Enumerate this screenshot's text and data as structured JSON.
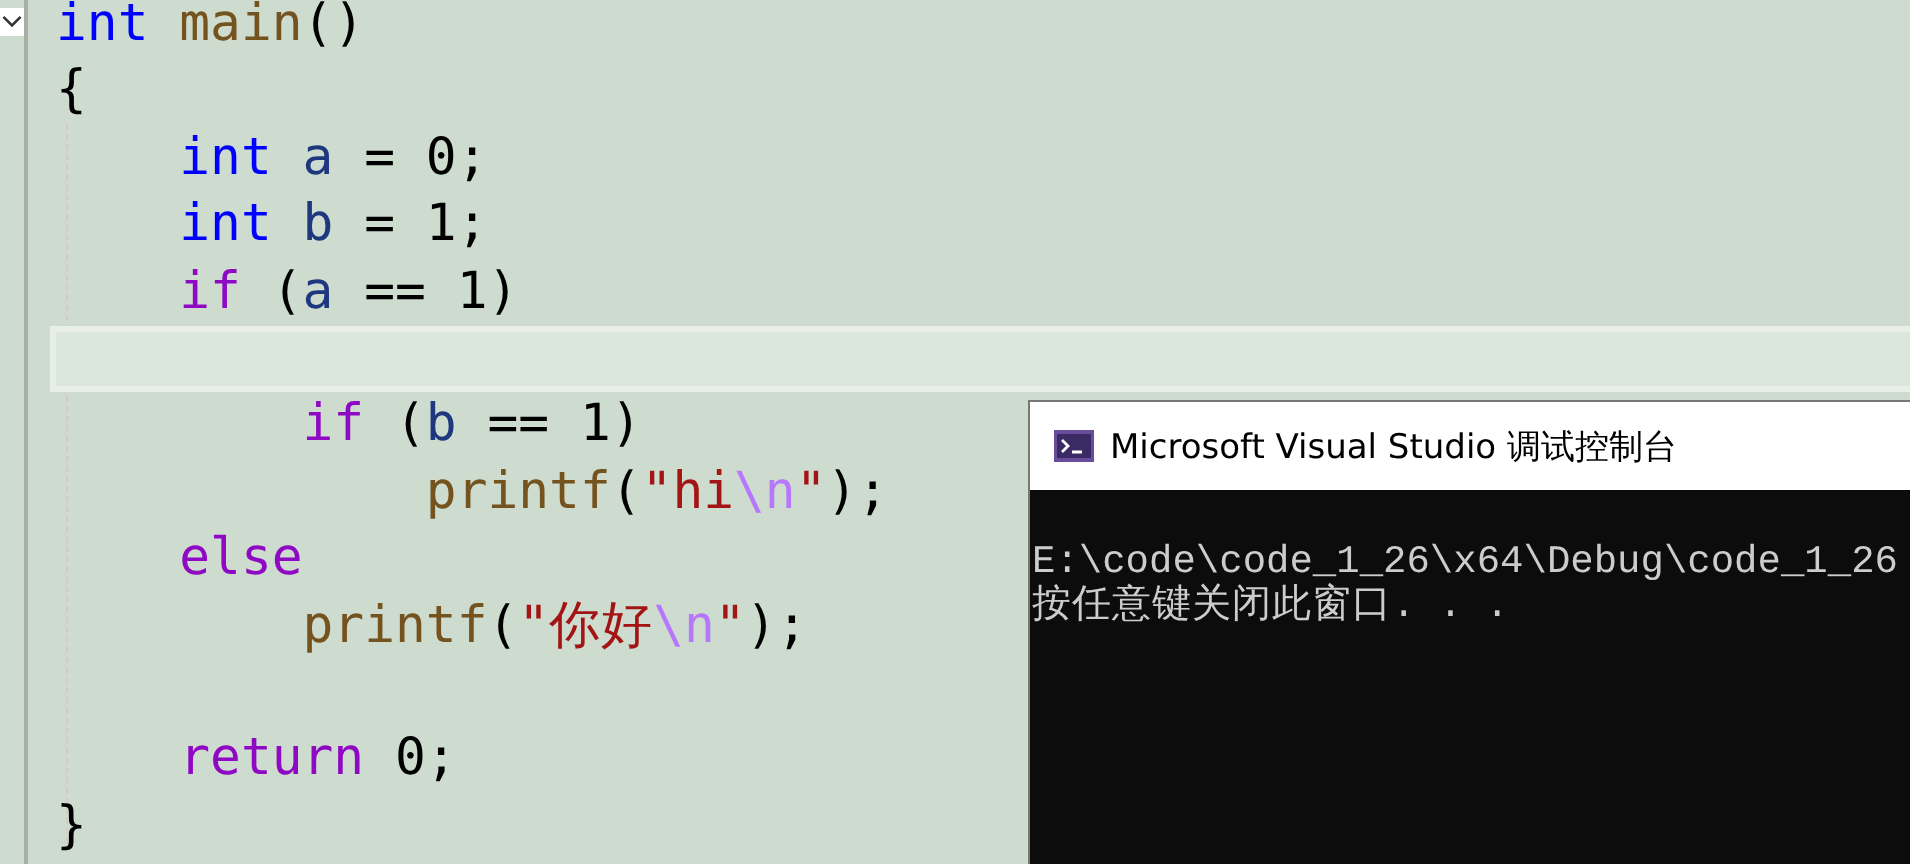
{
  "editor": {
    "lines": [
      {
        "current": false,
        "expanded": true,
        "tokens": [
          {
            "text": "int",
            "kind": "keyword"
          },
          {
            "text": " main",
            "kind": "function"
          },
          {
            "text": "()",
            "kind": "plain"
          }
        ]
      },
      {
        "current": false,
        "tokens": [
          {
            "text": "{",
            "kind": "plain"
          }
        ]
      },
      {
        "current": false,
        "tokens": [
          {
            "text": "    int",
            "kind": "keyword"
          },
          {
            "text": " a",
            "kind": "variable"
          },
          {
            "text": " = 0;",
            "kind": "plain"
          }
        ]
      },
      {
        "current": false,
        "tokens": [
          {
            "text": "    int",
            "kind": "keyword"
          },
          {
            "text": " b",
            "kind": "variable"
          },
          {
            "text": " = 1;",
            "kind": "plain"
          }
        ]
      },
      {
        "current": false,
        "tokens": [
          {
            "text": "    if",
            "kind": "control"
          },
          {
            "text": " (",
            "kind": "plain"
          },
          {
            "text": "a",
            "kind": "variable"
          },
          {
            "text": " == 1)",
            "kind": "plain"
          }
        ]
      },
      {
        "current": true
      },
      {
        "current": false,
        "tokens": [
          {
            "text": "        if",
            "kind": "control"
          },
          {
            "text": " (",
            "kind": "plain"
          },
          {
            "text": "b",
            "kind": "variable"
          },
          {
            "text": " == 1)",
            "kind": "plain"
          }
        ]
      },
      {
        "current": false,
        "tokens": [
          {
            "text": "            printf",
            "kind": "function"
          },
          {
            "text": "(",
            "kind": "plain"
          },
          {
            "text": "\"hi",
            "kind": "string"
          },
          {
            "text": "\\n",
            "kind": "escape"
          },
          {
            "text": "\"",
            "kind": "string"
          },
          {
            "text": ");",
            "kind": "plain"
          }
        ]
      },
      {
        "current": false,
        "tokens": [
          {
            "text": "    else",
            "kind": "control"
          }
        ]
      },
      {
        "current": false,
        "tokens": [
          {
            "text": "        printf",
            "kind": "function"
          },
          {
            "text": "(",
            "kind": "plain"
          },
          {
            "text": "\"你好",
            "kind": "string"
          },
          {
            "text": "\\n",
            "kind": "escape"
          },
          {
            "text": "\"",
            "kind": "string"
          },
          {
            "text": ");",
            "kind": "plain"
          }
        ]
      },
      {
        "current": false
      },
      {
        "current": false,
        "tokens": [
          {
            "text": "    return",
            "kind": "control"
          },
          {
            "text": " 0;",
            "kind": "plain"
          }
        ]
      },
      {
        "current": false,
        "tokens": [
          {
            "text": "}",
            "kind": "plain"
          }
        ]
      }
    ]
  },
  "console": {
    "title": "Microsoft Visual Studio 调试控制台",
    "lines": [
      "E:\\code\\code_1_26\\x64\\Debug\\code_1_26",
      "按任意键关闭此窗口. . ."
    ]
  }
}
